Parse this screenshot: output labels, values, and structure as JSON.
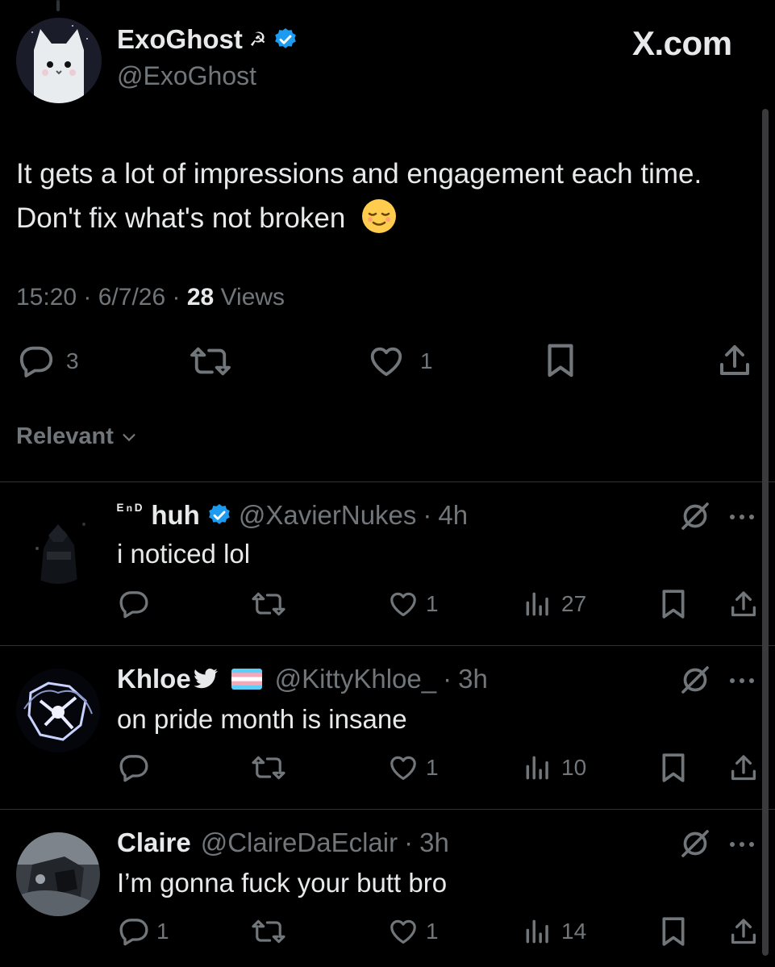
{
  "post": {
    "author_name": "ExoGhost",
    "author_symbol": "☭",
    "author_handle": "@ExoGhost",
    "brand": "X.com",
    "text": "It gets a lot of impressions and engagement each time. Don't fix what's not broken",
    "emoji": "😌",
    "time": "15:20",
    "date": "6/7/26",
    "views_count": "28",
    "views_label": "Views",
    "replies": "3",
    "likes": "1"
  },
  "filter": {
    "label": "Relevant"
  },
  "replies": [
    {
      "name_prefix": "ᴱⁿᴰ",
      "name": "huh",
      "verified": true,
      "handle": "@XavierNukes",
      "time": "4h",
      "text": "i noticed lol",
      "replies": "",
      "likes": "1",
      "views": "27"
    },
    {
      "name": "Khloe",
      "handle": "@KittyKhloe_",
      "time": "3h",
      "text": "on pride month is insane",
      "replies": "",
      "likes": "1",
      "views": "10"
    },
    {
      "name": "Claire",
      "handle": "@ClaireDaEclair",
      "time": "3h",
      "text": "I’m gonna fuck your butt bro",
      "replies": "1",
      "likes": "1",
      "views": "14"
    }
  ],
  "colors": {
    "background": "#000000",
    "text": "#e7e9ea",
    "muted": "#71767b",
    "verified": "#1d9bf0",
    "divider": "#2f3336"
  },
  "icons": [
    "reply-icon",
    "repost-icon",
    "like-icon",
    "bookmark-icon",
    "share-icon",
    "views-icon",
    "grok-icon",
    "more-icon",
    "verified-icon",
    "bird-icon",
    "trans-flag-icon",
    "chevron-down-icon"
  ]
}
